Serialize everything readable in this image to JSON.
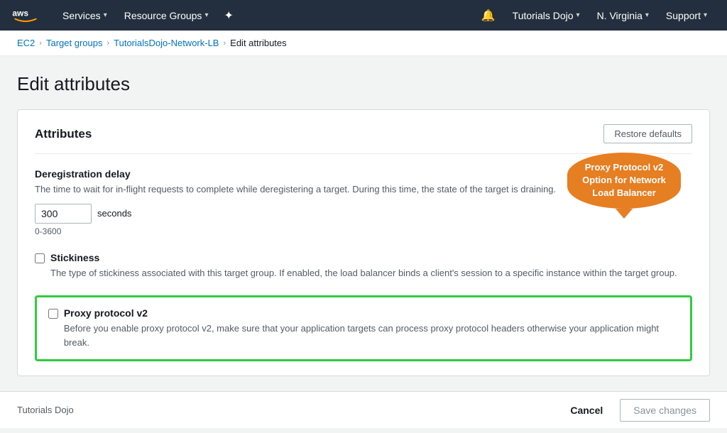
{
  "nav": {
    "services_label": "Services",
    "resource_groups_label": "Resource Groups",
    "tutorials_dojo_label": "Tutorials Dojo",
    "region_label": "N. Virginia",
    "support_label": "Support"
  },
  "breadcrumb": {
    "ec2": "EC2",
    "target_groups": "Target groups",
    "lb_name": "TutorialsDojo-Network-LB",
    "current": "Edit attributes"
  },
  "page": {
    "title": "Edit attributes"
  },
  "card": {
    "title": "Attributes",
    "restore_btn": "Restore defaults",
    "deregistration": {
      "title": "Deregistration delay",
      "desc": "The time to wait for in-flight requests to complete while deregistering a target. During this time, the state of the target is draining.",
      "value": "300",
      "unit": "seconds",
      "range": "0-3600"
    },
    "stickiness": {
      "title": "Stickiness",
      "desc": "The type of stickiness associated with this target group. If enabled, the load balancer binds a client's session to a specific instance within the target group.",
      "checked": false
    },
    "proxy_protocol": {
      "title": "Proxy protocol v2",
      "desc": "Before you enable proxy protocol v2, make sure that your application targets can process proxy protocol headers otherwise your application might break.",
      "checked": false
    }
  },
  "tooltip": {
    "text": "Proxy Protocol v2 Option for Network Load Balancer"
  },
  "footer": {
    "brand": "Tutorials Dojo",
    "cancel_label": "Cancel",
    "save_label": "Save changes"
  }
}
